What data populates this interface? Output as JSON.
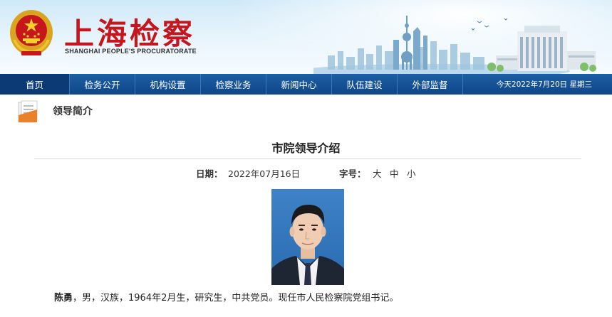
{
  "header": {
    "title": "上海检察",
    "subtitle": "SHANGHAI PEOPLE'S PROCURATORATE",
    "emblem_icon": "national-emblem-icon"
  },
  "nav": {
    "items": [
      {
        "label": "首页"
      },
      {
        "label": "检务公开"
      },
      {
        "label": "机构设置"
      },
      {
        "label": "检察业务"
      },
      {
        "label": "新闻中心"
      },
      {
        "label": "队伍建设"
      },
      {
        "label": "外部监督"
      }
    ],
    "date_text": "今天2022年7月20日 星期三"
  },
  "section": {
    "title": "领导简介",
    "icon": "document-icon"
  },
  "article": {
    "title": "市院领导介绍",
    "date_label": "日期：",
    "date_value": "2022年07月16日",
    "font_size_label": "字号：",
    "font_sizes": [
      "大",
      "中",
      "小"
    ],
    "bio_name": "陈勇",
    "bio_text": "，男，汉族，1964年2月生，研究生，中共党员。现任市人民检察院党组书记。"
  },
  "colors": {
    "brand_red": "#c4161c",
    "nav_blue": "#1a5aa0",
    "nav_active": "#0b3a74"
  }
}
